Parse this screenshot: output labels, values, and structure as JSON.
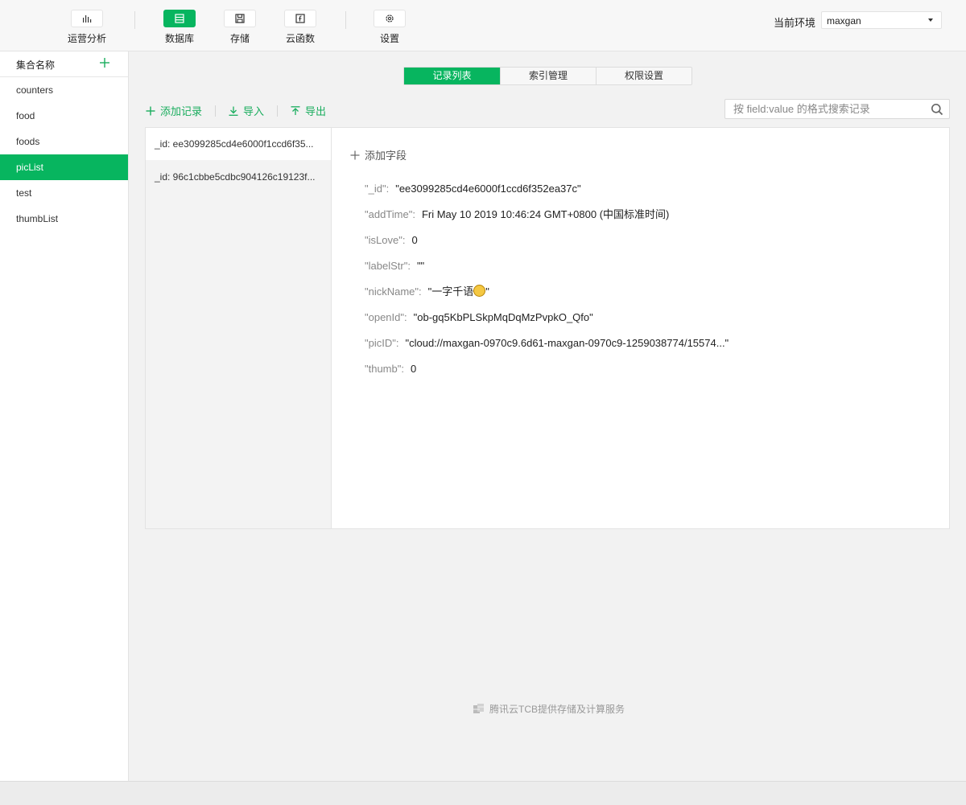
{
  "toolbar": {
    "items": [
      {
        "label": "运营分析",
        "icon": "bar-chart-icon",
        "active": false
      },
      {
        "label": "数据库",
        "icon": "database-icon",
        "active": true
      },
      {
        "label": "存储",
        "icon": "save-icon",
        "active": false
      },
      {
        "label": "云函数",
        "icon": "function-icon",
        "active": false
      },
      {
        "label": "设置",
        "icon": "gear-icon",
        "active": false
      }
    ],
    "env_label": "当前环境",
    "env_value": "maxgan"
  },
  "sidebar": {
    "title": "集合名称",
    "items": [
      {
        "label": "counters"
      },
      {
        "label": "food"
      },
      {
        "label": "foods"
      },
      {
        "label": "picList"
      },
      {
        "label": "test"
      },
      {
        "label": "thumbList"
      }
    ],
    "active_index": 3
  },
  "tabs": [
    {
      "label": "记录列表",
      "active": true
    },
    {
      "label": "索引管理",
      "active": false
    },
    {
      "label": "权限设置",
      "active": false
    }
  ],
  "actions": {
    "add": "添加记录",
    "import": "导入",
    "export": "导出"
  },
  "search": {
    "placeholder": "按 field:value 的格式搜索记录"
  },
  "records": [
    {
      "label": "_id: ee3099285cd4e6000f1ccd6f35..."
    },
    {
      "label": "_id: 96c1cbbe5cdbc904126c19123f..."
    }
  ],
  "detail": {
    "add_field": "添加字段",
    "fields": [
      {
        "key": "\"_id\"",
        "value": "\"ee3099285cd4e6000f1ccd6f352ea37c\""
      },
      {
        "key": "\"addTime\"",
        "value": "Fri May 10 2019 10:46:24 GMT+0800 (中国标准时间)"
      },
      {
        "key": "\"isLove\"",
        "value": "0"
      },
      {
        "key": "\"labelStr\"",
        "value": "\"\""
      },
      {
        "key": "\"nickName\"",
        "value_before": "\"一字千语",
        "value_after": "\""
      },
      {
        "key": "\"openId\"",
        "value": "\"ob-gq5KbPLSkpMqDqMzPvpkO_Qfo\""
      },
      {
        "key": "\"picID\"",
        "value": "\"cloud://maxgan-0970c9.6d61-maxgan-0970c9-1259038774/15574...\""
      },
      {
        "key": "\"thumb\"",
        "value": "0"
      }
    ]
  },
  "footer": {
    "text": "腾讯云TCB提供存储及计算服务"
  },
  "colors": {
    "accent": "#07b55f",
    "accent_text": "#1aad5e"
  }
}
